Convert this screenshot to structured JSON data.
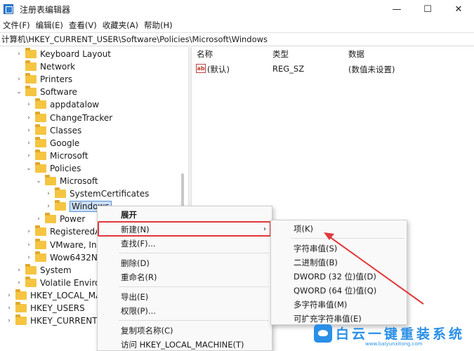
{
  "window": {
    "title": "注册表编辑器",
    "minimize": "—",
    "maximize": "☐",
    "close": "✕"
  },
  "menu": [
    "文件(F)",
    "编辑(E)",
    "查看(V)",
    "收藏夹(A)",
    "帮助(H)"
  ],
  "address": "计算机\\HKEY_CURRENT_USER\\Software\\Policies\\Microsoft\\Windows",
  "tree": [
    {
      "label": "Keyboard Layout",
      "level": 2,
      "expander": "›"
    },
    {
      "label": "Network",
      "level": 2,
      "expander": ""
    },
    {
      "label": "Printers",
      "level": 2,
      "expander": "›"
    },
    {
      "label": "Software",
      "level": 2,
      "expander": "⌄"
    },
    {
      "label": "appdatalow",
      "level": 3,
      "expander": "›"
    },
    {
      "label": "ChangeTracker",
      "level": 3,
      "expander": "›"
    },
    {
      "label": "Classes",
      "level": 3,
      "expander": "›"
    },
    {
      "label": "Google",
      "level": 3,
      "expander": "›"
    },
    {
      "label": "Microsoft",
      "level": 3,
      "expander": "›"
    },
    {
      "label": "Policies",
      "level": 3,
      "expander": "⌄"
    },
    {
      "label": "Microsoft",
      "level": 4,
      "expander": "⌄"
    },
    {
      "label": "SystemCertificates",
      "level": 5,
      "expander": "›"
    },
    {
      "label": "Windows",
      "level": 5,
      "expander": "›",
      "selected": true
    },
    {
      "label": "Power",
      "level": 4,
      "expander": "›"
    },
    {
      "label": "RegisteredA",
      "level": 3,
      "expander": "›"
    },
    {
      "label": "VMware, In",
      "level": 3,
      "expander": "›"
    },
    {
      "label": "Wow6432N",
      "level": 3,
      "expander": "›"
    },
    {
      "label": "System",
      "level": 2,
      "expander": "›"
    },
    {
      "label": "Volatile Enviro",
      "level": 2,
      "expander": "›"
    },
    {
      "label": "HKEY_LOCAL_MA",
      "level": 1,
      "expander": "›"
    },
    {
      "label": "HKEY_USERS",
      "level": 1,
      "expander": "›"
    },
    {
      "label": "HKEY_CURRENT_",
      "level": 1,
      "expander": "›"
    }
  ],
  "list": {
    "headers": {
      "name": "名称",
      "type": "类型",
      "data": "数据"
    },
    "rows": [
      {
        "icon": "ab",
        "name": "(默认)",
        "type": "REG_SZ",
        "data": "(数值未设置)"
      }
    ]
  },
  "context_menu": {
    "items": [
      "展开",
      "新建(N)",
      "查找(F)...",
      "删除(D)",
      "重命名(R)",
      "导出(E)",
      "权限(P)...",
      "复制项名称(C)",
      "访问 HKEY_LOCAL_MACHINE(T)"
    ],
    "submenu_arrow": "›"
  },
  "submenu": {
    "items": [
      "项(K)",
      "字符串值(S)",
      "二进制值(B)",
      "DWORD (32 位)值(D)",
      "QWORD (64 位)值(Q)",
      "多字符串值(M)",
      "可扩充字符串值(E)"
    ]
  },
  "colors": {
    "highlight": "#e0393b",
    "selection": "#cce0f7",
    "folder": "#f5c542",
    "watermark": "#2a8fe6"
  },
  "watermark": {
    "text": "白云一键重装系统",
    "url": "www.baiyunxitong.com"
  }
}
